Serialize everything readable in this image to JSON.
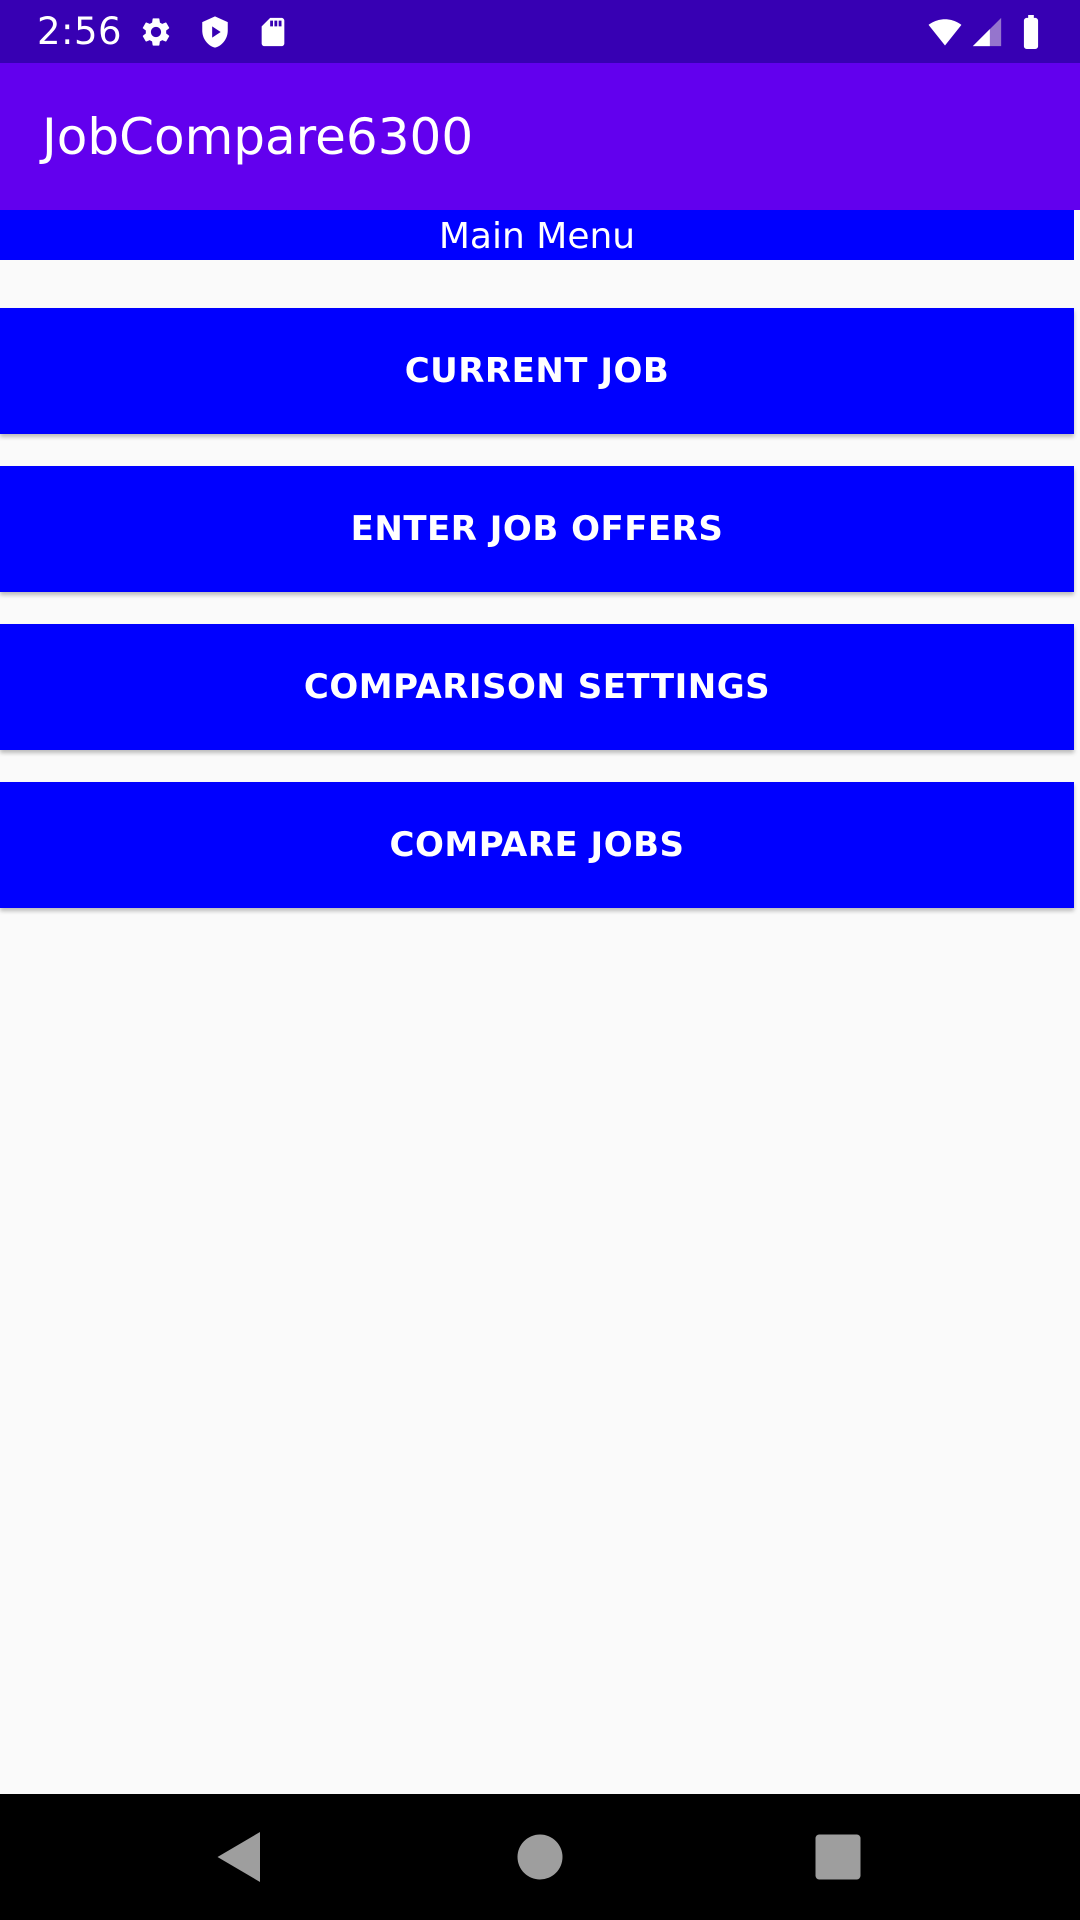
{
  "status_bar": {
    "time": "2:56",
    "background": "#3700B3",
    "icons": [
      "settings-gear-icon",
      "play-protect-shield-icon",
      "sd-card-icon",
      "wifi-icon",
      "cellular-signal-icon",
      "battery-icon"
    ]
  },
  "app_bar": {
    "title": "JobCompare6300",
    "background": "#6200EE"
  },
  "main": {
    "header": "Main Menu",
    "accent": "#0000FF",
    "buttons": [
      {
        "label": "CURRENT JOB"
      },
      {
        "label": "ENTER JOB OFFERS"
      },
      {
        "label": "COMPARISON SETTINGS"
      },
      {
        "label": "COMPARE JOBS"
      }
    ]
  },
  "nav_bar": {
    "icons": [
      "back-icon",
      "home-icon",
      "recents-icon"
    ],
    "icon_color": "#9E9E9E"
  }
}
